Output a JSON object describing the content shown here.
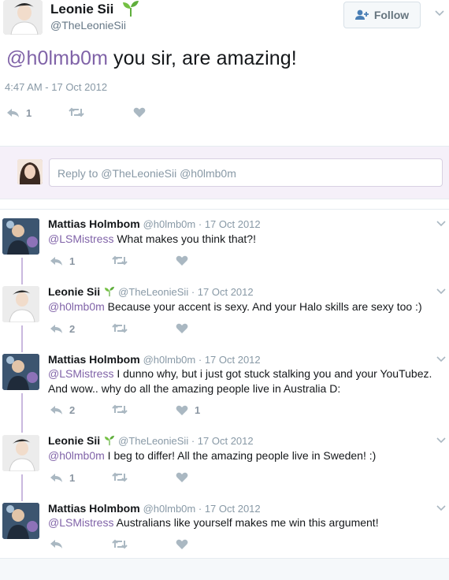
{
  "main_tweet": {
    "name": "Leonie Sii",
    "handle": "@TheLeonieSii",
    "follow_label": "Follow",
    "mention": "@h0lmb0m",
    "text": " you sir, are amazing!",
    "timestamp": "4:47 AM - 17 Oct 2012",
    "reply_count": "1",
    "retweet_count": "",
    "like_count": ""
  },
  "reply_box": {
    "placeholder": "Reply to @TheLeonieSii @h0lmb0m"
  },
  "thread": [
    {
      "name": "Mattias Holmbom",
      "handle": "@h0lmb0m",
      "date": "17 Oct 2012",
      "mention": "@LSMistress",
      "text": " What makes you think that?!",
      "text2": "",
      "reply_count": "1",
      "like_count": ""
    },
    {
      "name": "Leonie Sii",
      "handle": "@TheLeonieSii",
      "date": "17 Oct 2012",
      "mention": "@h0lmb0m",
      "text": " Because your accent is sexy. And your Halo skills are sexy too :)",
      "text2": "",
      "reply_count": "2",
      "like_count": ""
    },
    {
      "name": "Mattias Holmbom",
      "handle": "@h0lmb0m",
      "date": "17 Oct 2012",
      "mention": "@LSMistress",
      "text": " I dunno why, but i just got stuck stalking you and your YouTubez.",
      "text2": "And wow.. why do all the amazing people live in Australia D:",
      "reply_count": "2",
      "like_count": "1"
    },
    {
      "name": "Leonie Sii",
      "handle": "@TheLeonieSii",
      "date": "17 Oct 2012",
      "mention": "@h0lmb0m",
      "text": " I beg to differ! All the amazing people live in Sweden! :)",
      "text2": "",
      "reply_count": "1",
      "like_count": ""
    },
    {
      "name": "Mattias Holmbom",
      "handle": "@h0lmb0m",
      "date": "17 Oct 2012",
      "mention": "@LSMistress",
      "text": " Australians like yourself makes me win this argument!",
      "text2": "",
      "reply_count": "",
      "like_count": ""
    }
  ],
  "separator": " · ",
  "icons": {
    "reply": "reply-icon",
    "retweet": "retweet-icon",
    "like": "heart-icon",
    "more": "chevron-down-icon",
    "verified_sprout": "sprout-icon",
    "follow": "add-user-icon"
  },
  "colors": {
    "mention": "#8063a8",
    "thread_line": "#c9b8de",
    "icon_gray": "#aab8c2",
    "reply_band": "#f5f0f9"
  }
}
